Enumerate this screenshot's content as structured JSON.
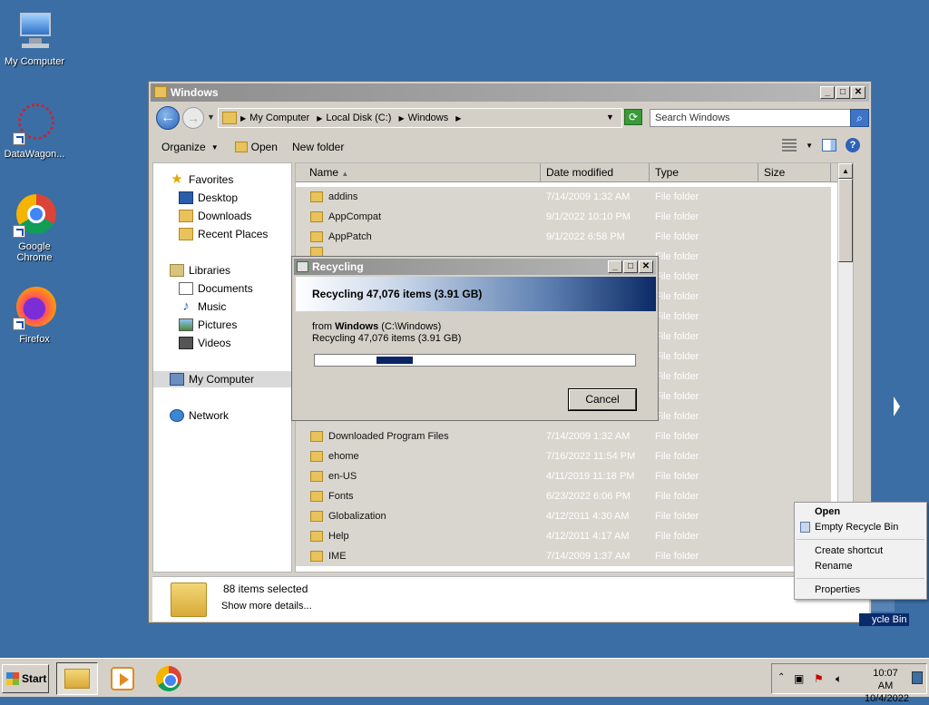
{
  "desktop": {
    "icons": [
      {
        "label": "My Computer",
        "icon": "computer-icon"
      },
      {
        "label": "DataWagon...",
        "icon": "datawagon-icon"
      },
      {
        "label": "Google Chrome",
        "icon": "chrome-icon"
      },
      {
        "label": "Firefox",
        "icon": "firefox-icon"
      }
    ],
    "recycle_bin_label": "ycle Bin"
  },
  "explorer": {
    "title": "Windows",
    "breadcrumbs": [
      "My Computer",
      "Local Disk (C:)",
      "Windows"
    ],
    "search_placeholder": "Search Windows",
    "toolbar": {
      "organize": "Organize",
      "open": "Open",
      "new_folder": "New folder"
    },
    "nav": {
      "favorites": "Favorites",
      "desktop": "Desktop",
      "downloads": "Downloads",
      "recent_places": "Recent Places",
      "libraries": "Libraries",
      "documents": "Documents",
      "music": "Music",
      "pictures": "Pictures",
      "videos": "Videos",
      "my_computer": "My Computer",
      "network": "Network"
    },
    "columns": {
      "name": "Name",
      "date_modified": "Date modified",
      "type": "Type",
      "size": "Size"
    },
    "rows": [
      {
        "name": "addins",
        "date": "7/14/2009 1:32 AM",
        "type": "File folder"
      },
      {
        "name": "AppCompat",
        "date": "9/1/2022 10:10 PM",
        "type": "File folder"
      },
      {
        "name": "AppPatch",
        "date": "9/1/2022 6:58 PM",
        "type": "File folder"
      },
      {
        "name": "",
        "date": "",
        "type": "File folder"
      },
      {
        "name": "",
        "date": "",
        "type": "File folder"
      },
      {
        "name": "",
        "date": "",
        "type": "File folder"
      },
      {
        "name": "",
        "date": "",
        "type": "File folder"
      },
      {
        "name": "",
        "date": "",
        "type": "File folder"
      },
      {
        "name": "",
        "date": "",
        "type": "File folder"
      },
      {
        "name": "",
        "date": "",
        "type": "File folder"
      },
      {
        "name": "",
        "date": "",
        "type": "File folder"
      },
      {
        "name": "",
        "date": "",
        "type": "File folder"
      },
      {
        "name": "Downloaded Program Files",
        "date": "7/14/2009 1:32 AM",
        "type": "File folder"
      },
      {
        "name": "ehome",
        "date": "7/16/2022 11:54 PM",
        "type": "File folder"
      },
      {
        "name": "en-US",
        "date": "4/11/2019 11:18 PM",
        "type": "File folder"
      },
      {
        "name": "Fonts",
        "date": "6/23/2022 6:06 PM",
        "type": "File folder"
      },
      {
        "name": "Globalization",
        "date": "4/12/2011 4:30 AM",
        "type": "File folder"
      },
      {
        "name": "Help",
        "date": "4/12/2011 4:17 AM",
        "type": "File folder"
      },
      {
        "name": "IME",
        "date": "7/14/2009 1:37 AM",
        "type": "File folder"
      }
    ],
    "details": {
      "selected": "88 items selected",
      "more": "Show more details..."
    }
  },
  "dialog": {
    "title": "Recycling",
    "banner": "Recycling 47,076 items (3.91 GB)",
    "from_prefix": "from ",
    "from_name": "Windows",
    "from_path": " (C:\\Windows)",
    "subtext": "Recycling 47,076 items (3.91 GB)",
    "cancel": "Cancel"
  },
  "context_menu": {
    "open": "Open",
    "empty": "Empty Recycle Bin",
    "create_shortcut": "Create shortcut",
    "rename": "Rename",
    "properties": "Properties"
  },
  "taskbar": {
    "start": "Start",
    "time": "10:07 AM",
    "date": "10/4/2022"
  },
  "colors": {
    "desktop": "#3a6ea5",
    "selection": "#0a2a6b",
    "progress": "#0a2464"
  }
}
